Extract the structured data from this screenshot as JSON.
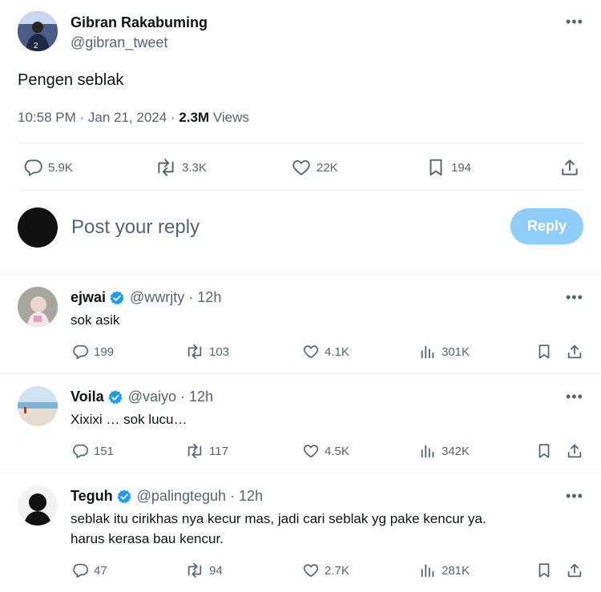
{
  "tweet": {
    "author_name": "Gibran Rakabuming",
    "author_handle": "@gibran_tweet",
    "text": "Pengen seblak",
    "timestamp": "10:58 PM · Jan 21, 2024 · ",
    "views_count": "2.3M",
    "views_label": " Views",
    "stats": {
      "replies": "5.9K",
      "retweets": "3.3K",
      "likes": "22K",
      "bookmarks": "194"
    },
    "avatar_jersey": "2"
  },
  "compose": {
    "placeholder": "Post your reply",
    "button_label": "Reply"
  },
  "replies": [
    {
      "name": "ejwai",
      "handle": "@wwrjty",
      "time": "12h",
      "text": "sok asik",
      "stats": {
        "replies": "199",
        "retweets": "103",
        "likes": "4.1K",
        "views": "301K"
      }
    },
    {
      "name": "Voila",
      "handle": "@vaiyo",
      "time": "12h",
      "text": "Xixixi … sok lucu…",
      "stats": {
        "replies": "151",
        "retweets": "117",
        "likes": "4.5K",
        "views": "342K"
      }
    },
    {
      "name": "Teguh",
      "handle": "@palingteguh",
      "time": "12h",
      "text_line1": "seblak itu cirikhas nya kecur mas, jadi cari seblak yg pake kencur ya.",
      "text_line2": "harus kerasa bau kencur.",
      "stats": {
        "replies": "47",
        "retweets": "94",
        "likes": "2.7K",
        "views": "281K"
      }
    }
  ],
  "separator": " · ",
  "colors": {
    "text": "#0f1419",
    "secondary": "#536471",
    "accent": "#1d9bf0",
    "reply_button_disabled": "#8ecdf8",
    "divider": "#eff3f4"
  },
  "icons": [
    "reply-icon",
    "retweet-icon",
    "like-icon",
    "bookmark-icon",
    "share-icon",
    "views-icon",
    "verified-badge-icon",
    "more-options-icon"
  ]
}
